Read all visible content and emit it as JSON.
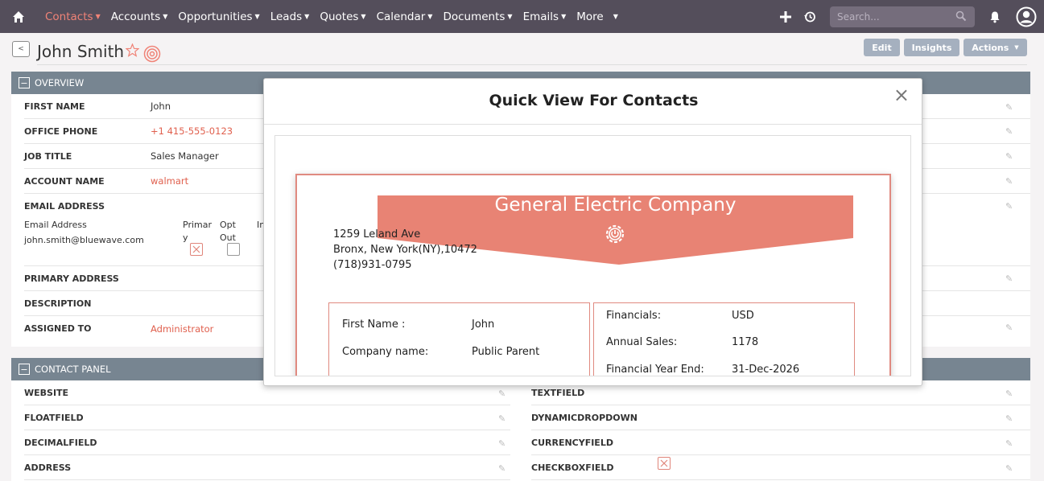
{
  "nav": {
    "items": [
      {
        "label": "Contacts",
        "active": true
      },
      {
        "label": "Accounts"
      },
      {
        "label": "Opportunities"
      },
      {
        "label": "Leads"
      },
      {
        "label": "Quotes"
      },
      {
        "label": "Calendar"
      },
      {
        "label": "Documents"
      },
      {
        "label": "Emails"
      },
      {
        "label": "More"
      }
    ],
    "search_placeholder": "Search...",
    "icons": [
      "home-icon",
      "plus-icon",
      "history-icon",
      "search-icon",
      "bell-icon",
      "user-icon"
    ]
  },
  "header": {
    "back_label": "<",
    "title": "John Smith",
    "buttons": {
      "edit": "Edit",
      "insights": "Insights",
      "actions": "Actions"
    }
  },
  "overview": {
    "title": "OVERVIEW",
    "toggle": "−",
    "first_name_label": "FIRST NAME",
    "first_name": "John",
    "office_phone_label": "OFFICE PHONE",
    "office_phone": "+1 415-555-0123",
    "job_title_label": "JOB TITLE",
    "job_title": "Sales Manager",
    "account_name_label": "ACCOUNT NAME",
    "account_name": "walmart",
    "email_label": "EMAIL ADDRESS",
    "email_sub_label": "Email Address",
    "email": "john.smith@bluewave.com",
    "primary_label_1": "Primar",
    "primary_label_2": "y",
    "optout_label_1": "Opt",
    "optout_label_2": "Out",
    "invalid_label": "In",
    "primary_address_label": "PRIMARY ADDRESS",
    "description_label": "DESCRIPTION",
    "assigned_to_label": "ASSIGNED TO",
    "assigned_to": "Administrator"
  },
  "contact_panel": {
    "title": "CONTACT PANEL",
    "toggle": "−",
    "left_fields": [
      "WEBSITE",
      "FLOATFIELD",
      "DECIMALFIELD",
      "ADDRESS"
    ],
    "right_fields": [
      "TEXTFIELD",
      "DYNAMICDROPDOWN",
      "CURRENCYFIELD",
      "CHECKBOXFIELD"
    ]
  },
  "modal": {
    "title": "Quick View For Contacts",
    "close": "×",
    "company": "General Electric Company",
    "address_line1": "1259 Leland Ave",
    "address_line2": "Bronx, New York(NY),10472",
    "phone": "(718)931-0795",
    "left_box": {
      "first_name_label": "First Name :",
      "first_name": "John",
      "company_label": "Company name:",
      "company": "Public Parent"
    },
    "right_box": {
      "financials_label": "Financials:",
      "financials": "USD",
      "annual_sales_label": "Annual Sales:",
      "annual_sales": "1178",
      "fye_label": "Financial Year End:",
      "fye": "31-Dec-2026"
    }
  },
  "colors": {
    "nav_bg": "#544e5b",
    "accent": "#f08377",
    "panel_head": "#778591",
    "banner": "#e88374"
  }
}
